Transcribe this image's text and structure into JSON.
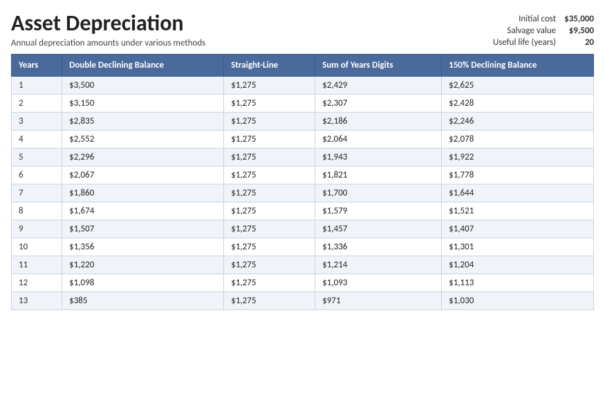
{
  "title": "Asset Depreciation",
  "subtitle": "Annual depreciation amounts under various methods",
  "info": {
    "initial_cost_label": "Initial cost",
    "initial_cost_value": "$35,000",
    "salvage_value_label": "Salvage value",
    "salvage_value_value": "$9,500",
    "useful_life_label": "Useful life (years)",
    "useful_life_value": "20"
  },
  "columns": [
    "Years",
    "Double Declining Balance",
    "Straight-Line",
    "Sum of Years Digits",
    "150% Declining Balance"
  ],
  "rows": [
    [
      "1",
      "$3,500",
      "$1,275",
      "$2,429",
      "$2,625"
    ],
    [
      "2",
      "$3,150",
      "$1,275",
      "$2,307",
      "$2,428"
    ],
    [
      "3",
      "$2,835",
      "$1,275",
      "$2,186",
      "$2,246"
    ],
    [
      "4",
      "$2,552",
      "$1,275",
      "$2,064",
      "$2,078"
    ],
    [
      "5",
      "$2,296",
      "$1,275",
      "$1,943",
      "$1,922"
    ],
    [
      "6",
      "$2,067",
      "$1,275",
      "$1,821",
      "$1,778"
    ],
    [
      "7",
      "$1,860",
      "$1,275",
      "$1,700",
      "$1,644"
    ],
    [
      "8",
      "$1,674",
      "$1,275",
      "$1,579",
      "$1,521"
    ],
    [
      "9",
      "$1,507",
      "$1,275",
      "$1,457",
      "$1,407"
    ],
    [
      "10",
      "$1,356",
      "$1,275",
      "$1,336",
      "$1,301"
    ],
    [
      "11",
      "$1,220",
      "$1,275",
      "$1,214",
      "$1,204"
    ],
    [
      "12",
      "$1,098",
      "$1,275",
      "$1,093",
      "$1,113"
    ],
    [
      "13",
      "$385",
      "$1,275",
      "$971",
      "$1,030"
    ]
  ]
}
